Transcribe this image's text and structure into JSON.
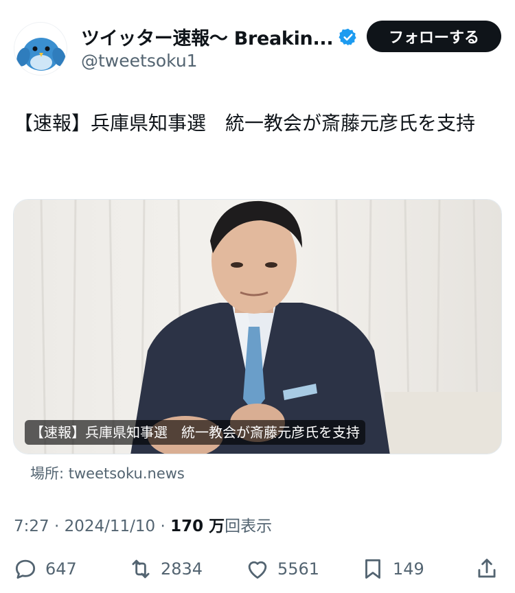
{
  "account": {
    "display_name": "ツイッター速報〜 Breakin...",
    "handle": "@tweetsoku1",
    "avatar_icon": "bird-avatar-icon",
    "verified_icon": "verified-badge-icon",
    "verified_color": "#1d9bf0"
  },
  "follow_button": {
    "label": "フォローする"
  },
  "tweet": {
    "text": "【速報】兵庫県知事選　統一教会が斎藤元彦氏を支持"
  },
  "media": {
    "caption": "【速報】兵庫県知事選　統一教会が斎藤元彦氏を支持"
  },
  "source": {
    "label": "場所: tweetsoku.news"
  },
  "meta": {
    "time": "7:27",
    "sep1": " · ",
    "date": "2024/11/10",
    "sep2": " · ",
    "views_count": "170 万",
    "views_label": "回表示"
  },
  "actions": {
    "reply_count": "647",
    "retweet_count": "2834",
    "like_count": "5561",
    "bookmark_count": "149"
  },
  "colors": {
    "text_primary": "#0f1419",
    "text_secondary": "#536471",
    "follow_bg": "#0f1419"
  }
}
